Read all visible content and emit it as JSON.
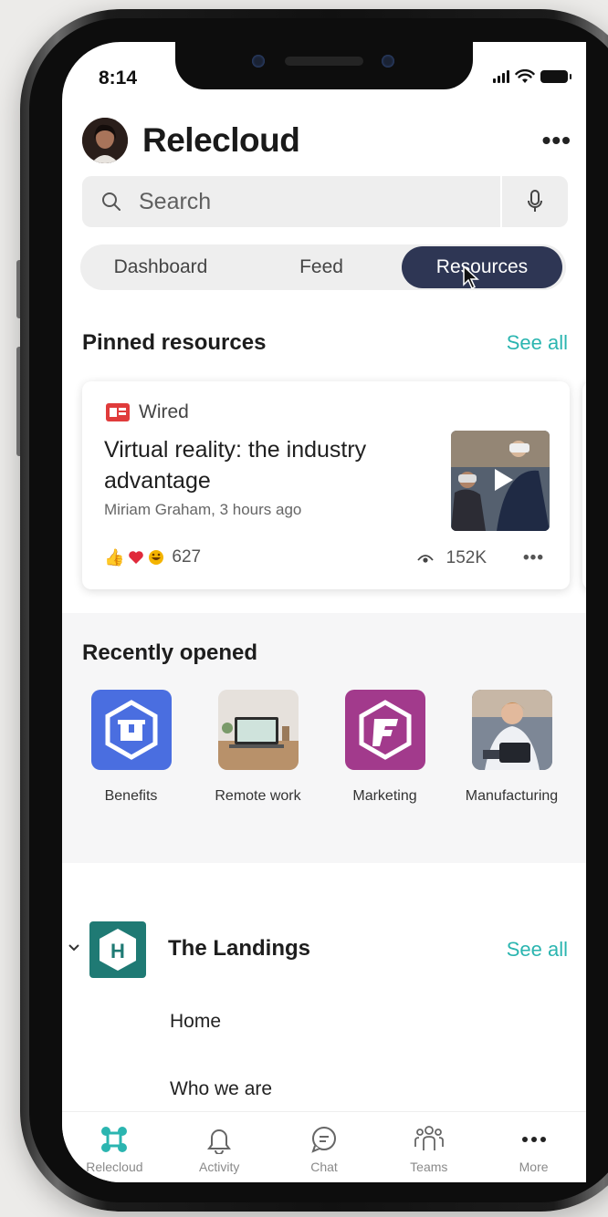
{
  "status": {
    "time": "8:14"
  },
  "header": {
    "title": "Relecloud",
    "more_label": "•••"
  },
  "search": {
    "placeholder": "Search"
  },
  "tabs": [
    {
      "label": "Dashboard",
      "active": false
    },
    {
      "label": "Feed",
      "active": false
    },
    {
      "label": "Resources",
      "active": true
    }
  ],
  "pinned": {
    "title": "Pinned resources",
    "see_all": "See all",
    "card": {
      "source": "Wired",
      "title": "Virtual reality: the industry advantage",
      "meta": "Miriam Graham, 3 hours ago",
      "reaction_count": "627",
      "views": "152K",
      "more_label": "•••"
    }
  },
  "recent": {
    "title": "Recently opened",
    "items": [
      {
        "label": "Benefits",
        "color": "#4a6ee0"
      },
      {
        "label": "Remote work"
      },
      {
        "label": "Marketing",
        "color": "#a23a8c"
      },
      {
        "label": "Manufacturing"
      }
    ]
  },
  "landings": {
    "title": "The Landings",
    "see_all": "See all",
    "icon_letter": "H",
    "items": [
      "Home",
      "Who we are"
    ]
  },
  "tabbar": [
    {
      "label": "Relecloud",
      "icon": "relecloud-icon",
      "active": true
    },
    {
      "label": "Activity",
      "icon": "bell-icon"
    },
    {
      "label": "Chat",
      "icon": "chat-icon"
    },
    {
      "label": "Teams",
      "icon": "teams-icon"
    },
    {
      "label": "More",
      "icon": "more-icon"
    }
  ],
  "colors": {
    "accent": "#2bb5b0",
    "active_tab": "#2e3654",
    "brand_teal": "#1f7a74"
  }
}
